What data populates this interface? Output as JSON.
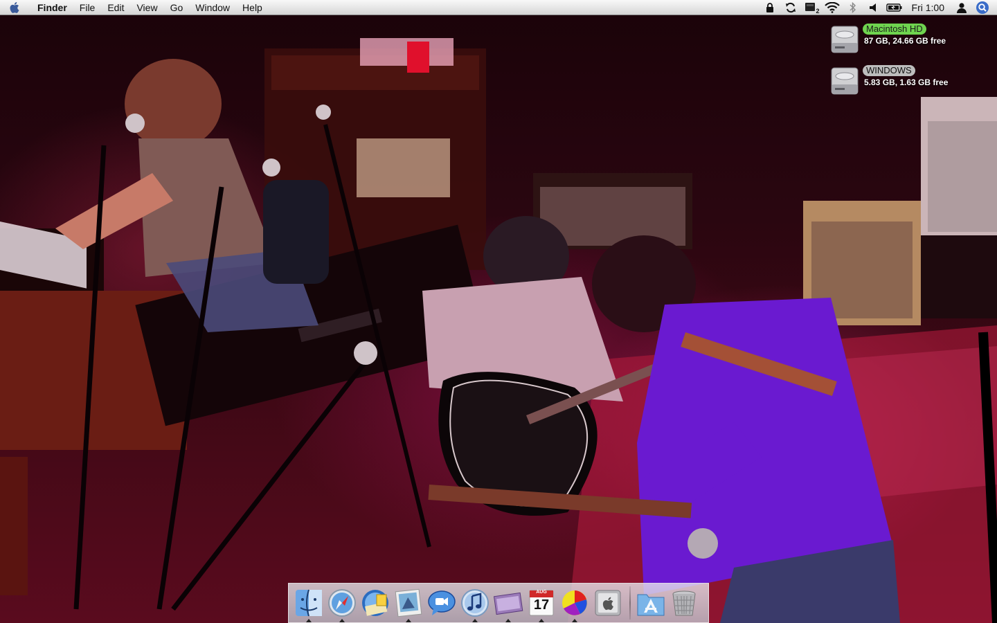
{
  "menubar": {
    "apple_icon": "apple-icon",
    "items": [
      "Finder",
      "File",
      "Edit",
      "View",
      "Go",
      "Window",
      "Help"
    ],
    "status_icons": [
      "lock-icon",
      "sync-icon",
      "spaces-icon",
      "wifi-icon",
      "bluetooth-icon",
      "volume-icon",
      "battery-icon"
    ],
    "spaces_number": "2",
    "clock": "Fri 1:00",
    "user_icon": "user-icon",
    "spotlight_icon": "spotlight-icon"
  },
  "desktop": {
    "volumes": [
      {
        "name": "Macintosh HD",
        "info": "87 GB, 24.66 GB free",
        "label_color": "#6fd44f"
      },
      {
        "name": "WINDOWS",
        "info": "5.83 GB, 1.63 GB free",
        "label_color": "#bdbdbd"
      }
    ]
  },
  "dock": {
    "apps": [
      {
        "name": "Finder",
        "icon": "finder-icon",
        "running": true
      },
      {
        "name": "Safari",
        "icon": "safari-icon",
        "running": true
      },
      {
        "name": "Mail",
        "icon": "mail-icon",
        "running": false
      },
      {
        "name": "Preview",
        "icon": "preview-icon",
        "running": true
      },
      {
        "name": "iChat",
        "icon": "ichat-icon",
        "running": false
      },
      {
        "name": "iTunes",
        "icon": "itunes-icon",
        "running": true
      },
      {
        "name": "iMovie",
        "icon": "imovie-icon",
        "running": true
      },
      {
        "name": "iCal",
        "icon": "ical-icon",
        "running": true,
        "date": "17",
        "month": "AUG"
      },
      {
        "name": "Chart",
        "icon": "pie-chart-icon",
        "running": true
      },
      {
        "name": "System Preferences",
        "icon": "system-preferences-icon",
        "running": false
      }
    ],
    "stacks": [
      {
        "name": "Applications",
        "icon": "applications-folder-icon"
      },
      {
        "name": "Trash",
        "icon": "trash-icon"
      }
    ]
  }
}
